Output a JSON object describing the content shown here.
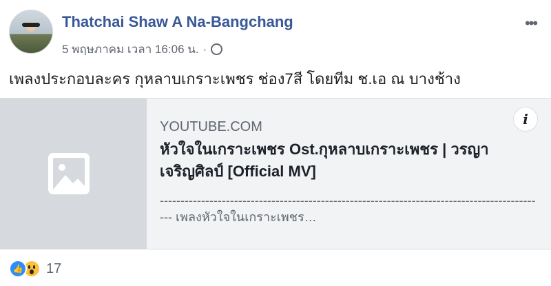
{
  "post": {
    "author": "Thatchai Shaw A Na-Bangchang",
    "timestamp": "5 พฤษภาคม เวลา 16:06 น.",
    "separator": "·",
    "more_icon": "more-horizontal-icon",
    "privacy_icon": "globe-icon",
    "text": "เพลงประกอบละคร กุหลาบเกราะเพชร ช่อง7สี โดยทีม ช.เอ ณ บางช้าง"
  },
  "link_card": {
    "domain": "YOUTUBE.COM",
    "title": "หัวใจในเกราะเพชร Ost.กุหลาบเกราะเพชร | วรญา เจริญศิลป์ [Official MV]",
    "description": "---------------------------------------------------------------------------------------------- เพลงหัวใจในเกราะเพชร…",
    "info_label": "i"
  },
  "reactions": {
    "icons": [
      "like-icon",
      "wow-icon"
    ],
    "count": "17"
  }
}
